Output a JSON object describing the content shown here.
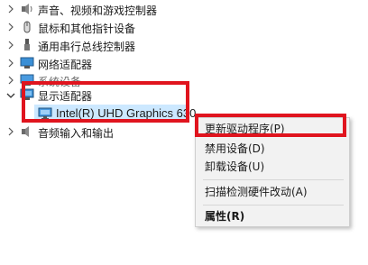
{
  "tree": {
    "items": [
      {
        "label": "声音、视频和游戏控制器",
        "icon": "speaker-icon",
        "expanded": false
      },
      {
        "label": "鼠标和其他指针设备",
        "icon": "mouse-icon",
        "expanded": false
      },
      {
        "label": "通用串行总线控制器",
        "icon": "usb-icon",
        "expanded": false
      },
      {
        "label": "网络适配器",
        "icon": "network-adapter-icon",
        "expanded": false
      },
      {
        "label": "系统设备",
        "icon": "system-device-icon",
        "expanded": false
      },
      {
        "label": "显示适配器",
        "icon": "display-adapter-icon",
        "expanded": true
      },
      {
        "label": "音频输入和输出",
        "icon": "audio-io-icon",
        "expanded": false
      }
    ],
    "child": {
      "label": "Intel(R) UHD Graphics 630",
      "icon": "monitor-icon"
    }
  },
  "context_menu": {
    "items": [
      {
        "label": "更新驱动程序(P)",
        "bold": false
      },
      {
        "label": "禁用设备(D)",
        "bold": false
      },
      {
        "label": "卸载设备(U)",
        "bold": false
      },
      {
        "label": "扫描检测硬件改动(A)",
        "bold": false
      },
      {
        "label": "属性(R)",
        "bold": true
      }
    ]
  },
  "colors": {
    "highlight_box": "#e0141e",
    "selection": "#cce8ff",
    "menu_bg": "#f2f2f2"
  }
}
